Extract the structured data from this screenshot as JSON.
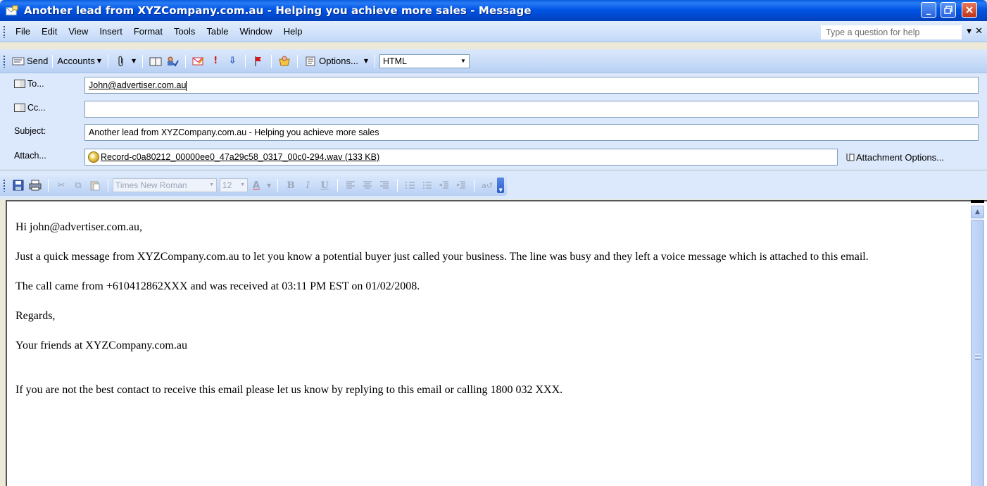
{
  "window": {
    "title": "Another lead from XYZCompany.com.au - Helping you achieve more sales - Message",
    "controls": [
      "minimize",
      "maximize",
      "close"
    ]
  },
  "menubar": {
    "items": [
      "File",
      "Edit",
      "View",
      "Insert",
      "Format",
      "Tools",
      "Table",
      "Window",
      "Help"
    ],
    "help_placeholder": "Type a question for help"
  },
  "toolbar": {
    "send_label": "Send",
    "accounts_label": "Accounts",
    "options_label": "Options...",
    "format_value": "HTML"
  },
  "header": {
    "to_label": "To...",
    "to_value": "John@advertiser.com.au",
    "cc_label": "Cc...",
    "cc_value": "",
    "subject_label": "Subject:",
    "subject_value": "Another lead from XYZCompany.com.au - Helping you achieve more sales",
    "attach_label": "Attach...",
    "attachment_name": "Record-c0a80212_00000ee0_47a29c58_0317_00c0-294.wav (133 KB)",
    "attachment_options_label": "Attachment Options..."
  },
  "format_toolbar": {
    "font_name": "Times New Roman",
    "font_size": "12",
    "bold": "B",
    "italic": "I",
    "underline": "U"
  },
  "body": {
    "greeting": "Hi john@advertiser.com.au,",
    "paragraph1": "Just a quick message from XYZCompany.com.au to let you know a potential buyer just called your business. The line was busy and they left a voice message which is attached to this email.",
    "paragraph2": "The call came from +610412862XXX and was received at 03:11 PM EST on 01/02/2008.",
    "closing": "Regards,",
    "signature": "Your friends at XYZCompany.com.au",
    "footer": "If you are not the best contact to receive this email please let us know by replying to this email or calling 1800 032 XXX."
  },
  "colors": {
    "titlebar": "#0055e5",
    "toolbar": "#c3d9f8",
    "header_bg": "#dce8fb"
  }
}
